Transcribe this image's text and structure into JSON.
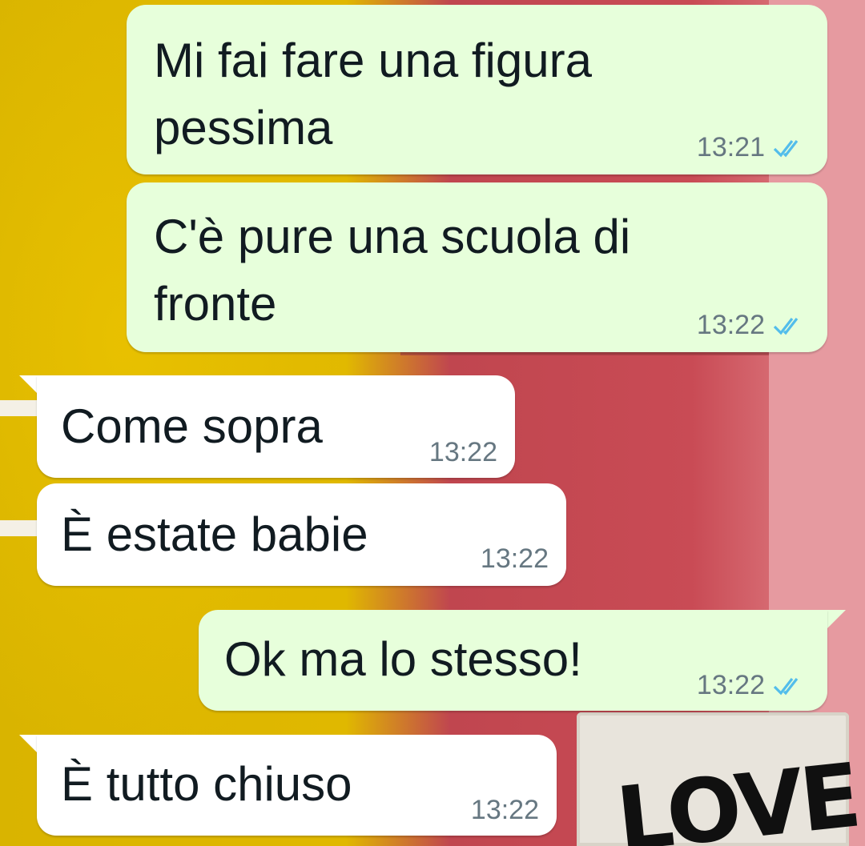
{
  "chat": {
    "messages": [
      {
        "direction": "outgoing",
        "text": "Mi fai fare una figura\npessima",
        "time": "13:21",
        "status_icon": "double-check-read-icon"
      },
      {
        "direction": "outgoing",
        "text": "C'è pure una scuola di\nfronte",
        "time": "13:22",
        "status_icon": "double-check-read-icon"
      },
      {
        "direction": "incoming",
        "text": "Come sopra",
        "time": "13:22"
      },
      {
        "direction": "incoming",
        "text": "È estate babie",
        "time": "13:22"
      },
      {
        "direction": "outgoing",
        "text": "Ok ma lo stesso!",
        "time": "13:22",
        "status_icon": "double-check-read-icon"
      },
      {
        "direction": "incoming",
        "text": "È tutto chiuso",
        "time": "13:22"
      }
    ]
  },
  "wallpaper": {
    "text": "LOVE"
  },
  "colors": {
    "outgoing_bubble": "#e7ffdb",
    "incoming_bubble": "#ffffff",
    "read_tick": "#53bdeb",
    "time_text": "#667781"
  }
}
